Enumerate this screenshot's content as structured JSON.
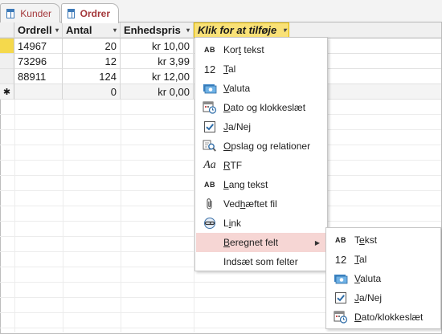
{
  "tabs": [
    {
      "label": "Kunder",
      "active": false
    },
    {
      "label": "Ordrer",
      "active": true
    }
  ],
  "columns": {
    "ordre": "Ordrell",
    "antal": "Antal",
    "pris": "Enhedspris",
    "add": "Klik for at tilføje"
  },
  "rows": [
    {
      "ordre": "14967",
      "antal": "20",
      "pris": "kr 10,00"
    },
    {
      "ordre": "73296",
      "antal": "12",
      "pris": "kr 3,99"
    },
    {
      "ordre": "88911",
      "antal": "124",
      "pris": "kr 12,00"
    }
  ],
  "new_row": {
    "marker": "✱",
    "ordre": "",
    "antal": "0",
    "pris": "kr 0,00"
  },
  "menu": {
    "items": [
      {
        "icon": "AB",
        "label": "Kort tekst",
        "ul": "t"
      },
      {
        "icon": "12",
        "label": "Tal",
        "ul": "T"
      },
      {
        "icon": "currency-icon",
        "label": "Valuta",
        "ul": "V"
      },
      {
        "icon": "date-time-icon",
        "label": "Dato og klokkeslæt",
        "ul": "D"
      },
      {
        "icon": "checkbox-icon",
        "label": "Ja/Nej",
        "ul": "J"
      },
      {
        "icon": "lookup-icon",
        "label": "Opslag og relationer",
        "ul": "O"
      },
      {
        "icon": "Aa",
        "label": "RTF",
        "ul": "R"
      },
      {
        "icon": "AB",
        "label": "Lang tekst",
        "ul": "L"
      },
      {
        "icon": "paperclip-icon",
        "label": "Vedhæftet fil",
        "ul": "h"
      },
      {
        "icon": "link-icon",
        "label": "Link",
        "ul": "i"
      },
      {
        "icon": "",
        "label": "Beregnet felt",
        "ul": "B",
        "highlighted": true,
        "submenu": true
      },
      {
        "icon": "",
        "label": "Indsæt som felter",
        "ul": ""
      }
    ]
  },
  "submenu": {
    "items": [
      {
        "icon": "AB",
        "label": "Tekst",
        "ul": "e"
      },
      {
        "icon": "12",
        "label": "Tal",
        "ul": "T"
      },
      {
        "icon": "currency-icon",
        "label": "Valuta",
        "ul": "V"
      },
      {
        "icon": "checkbox-icon",
        "label": "Ja/Nej",
        "ul": "J"
      },
      {
        "icon": "date-time-icon",
        "label": "Dato/klokkeslæt",
        "ul": "D"
      }
    ]
  },
  "colors": {
    "tab_text": "#a4373a",
    "selected_header": "#f9e177",
    "record_selector_current": "#f5d94c",
    "menu_highlight": "#f6d6d4"
  }
}
